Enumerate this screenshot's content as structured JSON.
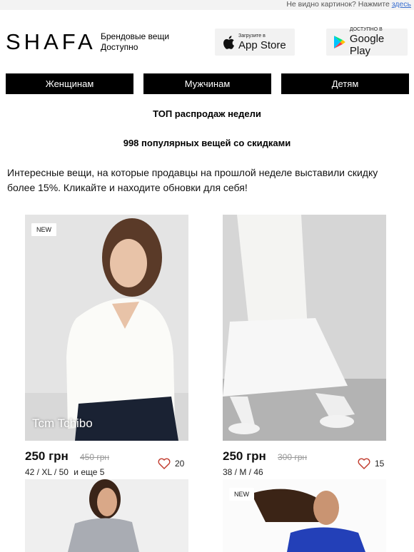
{
  "topbar": {
    "text": "Не видно картинок? Нажмите",
    "link": "здесь"
  },
  "header": {
    "logo": "SHAFA",
    "tagline_line1": "Брендовые вещи",
    "tagline_line2": "Доступно",
    "app_store": {
      "small": "Загрузите в",
      "big": "App Store",
      "icon": "apple-icon"
    },
    "google_play": {
      "small": "ДОСТУПНО В",
      "big": "Google Play",
      "icon": "google-play-icon"
    }
  },
  "nav": {
    "women": "Женщинам",
    "men": "Мужчинам",
    "kids": "Детям"
  },
  "headings": {
    "top": "ТОП распродаж недели",
    "count": "998 популярных вещей со скидками"
  },
  "intro": "Интересные вещи, на которые продавцы на прошлой неделе выставили скидку более 15%. Кликайте и находите обновки для себя!",
  "products": [
    {
      "badge": "NEW",
      "brand": "Tcm Tchibo",
      "price": "250 грн",
      "old_price": "450 грн",
      "sizes": "42 / XL / 50",
      "more": "и еще 5",
      "likes": "20"
    },
    {
      "badge": "",
      "brand": "",
      "price": "250 грн",
      "old_price": "300 грн",
      "sizes": "38 / M / 46",
      "more": "",
      "likes": "15"
    },
    {
      "badge": ""
    },
    {
      "badge": "NEW"
    }
  ],
  "colors": {
    "nav_bg": "#000000",
    "link": "#3a6fd0",
    "heart": "#c0392b"
  }
}
